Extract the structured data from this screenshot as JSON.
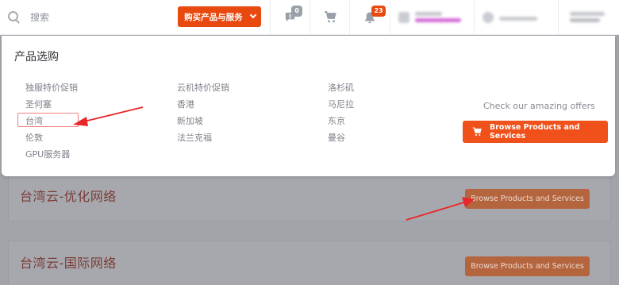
{
  "header": {
    "search_placeholder": "搜索",
    "buy_button_label": "购买产品与服务",
    "messages_badge": "0",
    "notifications_badge": "23"
  },
  "dropdown": {
    "title": "产品选购",
    "column1": [
      "独服特价促销",
      "圣何塞",
      "台湾",
      "伦敦",
      "GPU服务器"
    ],
    "column2": [
      "云机特价促销",
      "香港",
      "新加坡",
      "法兰克福"
    ],
    "column3": [
      "洛杉矶",
      "马尼拉",
      "东京",
      "曼谷"
    ],
    "offer_text": "Check our amazing offers",
    "browse_button_label": "Browse Products and Services"
  },
  "page": {
    "cards": [
      {
        "title": "台湾云-优化网络",
        "button_label": "Browse Products and Services"
      },
      {
        "title": "台湾云-国际网络",
        "button_label": "Browse Products and Services"
      }
    ]
  },
  "colors": {
    "accent": "#e8490f",
    "annotation_red": "#e8272a"
  }
}
